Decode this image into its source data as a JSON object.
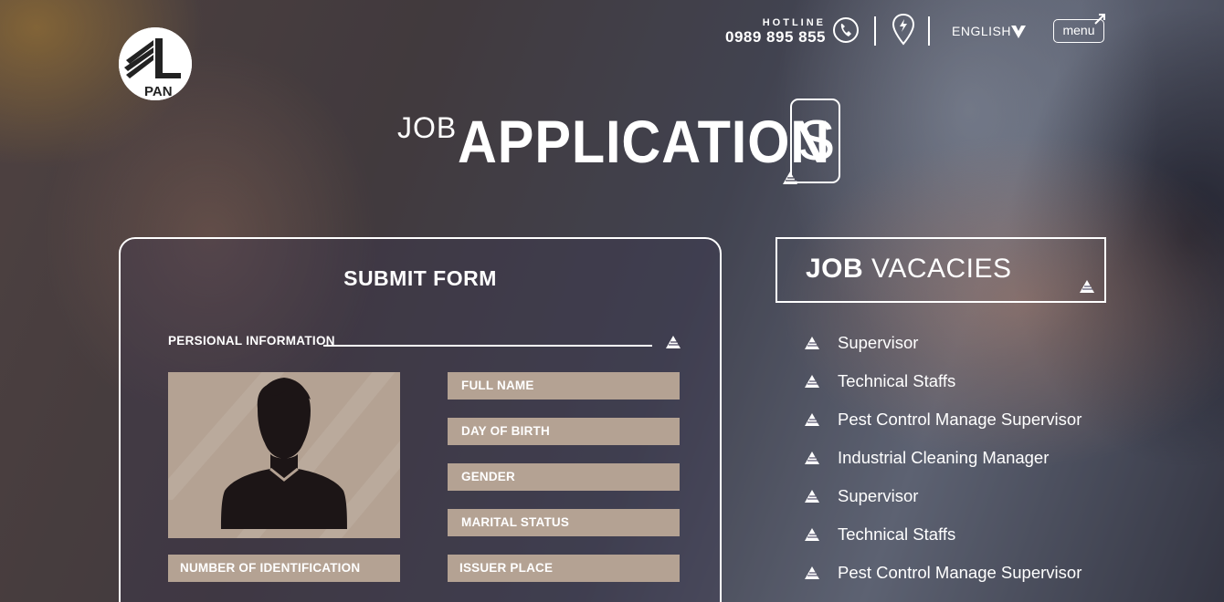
{
  "brand": {
    "logo_text": "PAN"
  },
  "header": {
    "hotline_label": "HOTLINE",
    "hotline_number": "0989 895 855",
    "language": "ENGLISH",
    "menu_label": "menu"
  },
  "page_title": {
    "prefix": "JOB",
    "main": "APPLICATION",
    "last_letter": "S"
  },
  "form": {
    "title": "SUBMIT FORM",
    "section_label": "PERSIONAL INFORMATION",
    "fields": {
      "full_name": "FULL NAME",
      "day_of_birth": "DAY OF BIRTH",
      "gender": "GENDER",
      "marital_status": "MARITAL STATUS",
      "identification": "NUMBER OF IDENTIFICATION",
      "issuer_place": "ISSUER PLACE"
    }
  },
  "vacancies": {
    "title_bold": "JOB",
    "title_rest": "VACACIES",
    "items": [
      "Supervisor",
      "Technical Staffs",
      "Pest Control Manage Supervisor",
      "Industrial Cleaning Manager",
      "Supervisor",
      "Technical Staffs",
      "Pest Control Manage Supervisor"
    ]
  },
  "colors": {
    "field_bg": "#b4a293",
    "text": "#ffffff"
  },
  "icons": [
    "pan-logo-icon",
    "phone-icon",
    "location-pin-icon",
    "chevron-down-icon",
    "triangle-mark-icon",
    "avatar-silhouette-icon"
  ]
}
